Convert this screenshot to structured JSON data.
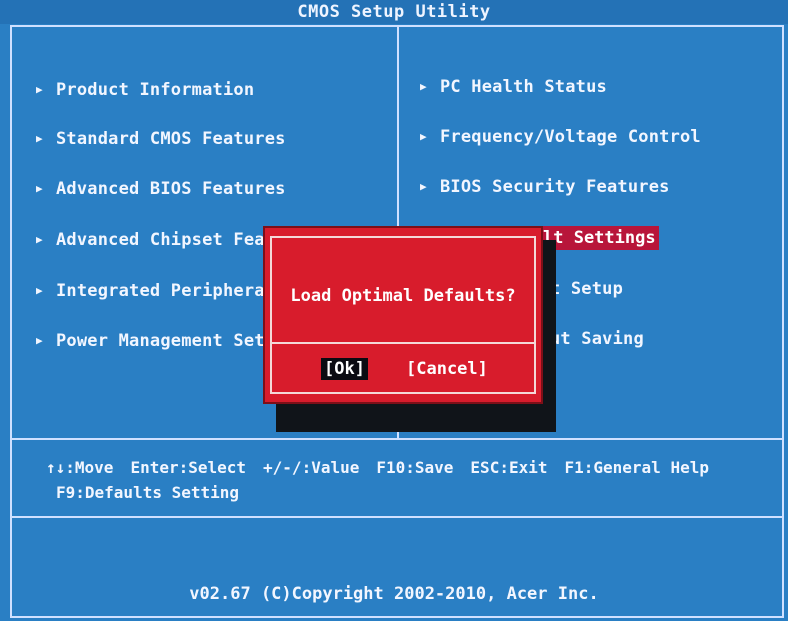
{
  "title": "CMOS Setup Utility",
  "left_menu": [
    "Product Information",
    "Standard CMOS Features",
    "Advanced BIOS Features",
    "Advanced Chipset Feat",
    "Integrated Peripheral",
    "Power Management Setu"
  ],
  "right_menu": [
    "PC Health Status",
    "Frequency/Voltage Control",
    "BIOS Security Features"
  ],
  "right_partial": [
    "lt Settings",
    "t Setup",
    "ut Saving"
  ],
  "help_line1": [
    "↑↓:Move",
    "Enter:Select",
    "+/-/:Value",
    "F10:Save",
    "ESC:Exit",
    "F1:General Help"
  ],
  "help_line2": "F9:Defaults Setting",
  "footer": "v02.67 (C)Copyright 2002-2010, Acer Inc.",
  "dialog": {
    "question": "Load Optimal Defaults?",
    "ok": "[Ok]",
    "cancel": "[Cancel]"
  },
  "colors": {
    "background": "#2a7fc4",
    "dialog": "#d81c2c",
    "highlight": "#b8153a"
  },
  "icons": {
    "menu_arrow": "right-triangle"
  }
}
